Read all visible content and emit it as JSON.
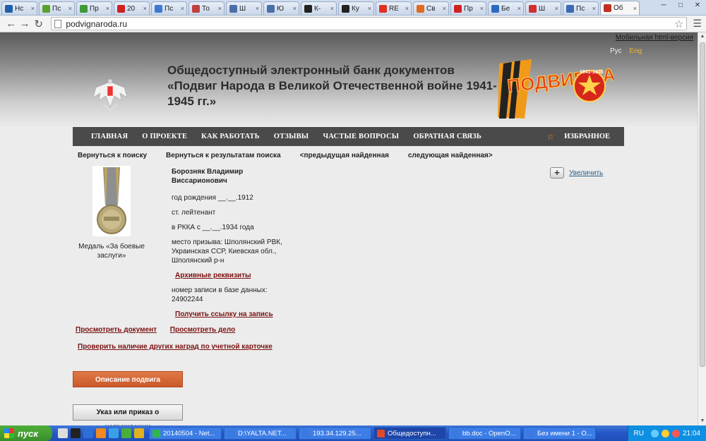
{
  "browser": {
    "tabs": [
      {
        "label": "Нс",
        "icon": "ni-icon",
        "color": "#1f5fa8"
      },
      {
        "label": "Пс",
        "icon": "green-f-icon",
        "color": "#5aa02c"
      },
      {
        "label": "Пр",
        "icon": "green-arrow-icon",
        "color": "#3f9a3a"
      },
      {
        "label": "20",
        "icon": "red-circle-icon",
        "color": "#d02020"
      },
      {
        "label": "Пс",
        "icon": "blue-page-icon",
        "color": "#3b7ad0"
      },
      {
        "label": "То",
        "icon": "pencil-icon",
        "color": "#c04040"
      },
      {
        "label": "Ш",
        "icon": "vk-icon",
        "color": "#4a6ea8"
      },
      {
        "label": "Ю",
        "icon": "vk-icon",
        "color": "#4a6ea8"
      },
      {
        "label": "К-",
        "icon": "iron-cross-icon",
        "color": "#222222"
      },
      {
        "label": "Ку",
        "icon": "iron-cross-icon",
        "color": "#222222"
      },
      {
        "label": "RE",
        "icon": "n-icon",
        "color": "#e03020"
      },
      {
        "label": "Св",
        "icon": "orange-page-icon",
        "color": "#e06a20"
      },
      {
        "label": "Пр",
        "icon": "red-ring-icon",
        "color": "#d02020"
      },
      {
        "label": "Бе",
        "icon": "arrow-icon",
        "color": "#2a6ac0"
      },
      {
        "label": "Ш",
        "icon": "red-circle-icon",
        "color": "#d03030"
      },
      {
        "label": "Пс",
        "icon": "eagle-icon",
        "color": "#3a6ab0"
      },
      {
        "label": "Об",
        "icon": "medal-icon",
        "color": "#c03020",
        "active": true
      }
    ],
    "url": "podvignaroda.ru"
  },
  "site": {
    "mobile_link": "Мобильная html-версия",
    "lang_ru": "Рус",
    "lang_en": "Eng",
    "title": "Общедоступный электронный банк документов «Подвиг Народа в Великой Отечественной войне 1941-1945 гг.»",
    "logo_text": "ПОДВИГ НАРОДА",
    "logo_years": "1941-1945"
  },
  "nav": {
    "items": [
      "ГЛАВНАЯ",
      "О ПРОЕКТЕ",
      "КАК РАБОТАТЬ",
      "ОТЗЫВЫ",
      "ЧАСТЫЕ ВОПРОСЫ",
      "ОБРАТНАЯ СВЯЗЬ"
    ],
    "favorites": "ИЗБРАННОЕ"
  },
  "subnav": {
    "back_search": "Вернуться к поиску",
    "back_results": "Вернуться к результатам поиска",
    "prev_found": "<предыдущая найденная",
    "next_found": "следующая найденная>"
  },
  "record": {
    "medal_caption": "Медаль «За боевые заслуги»",
    "name": "Борозняк Владимир Виссарионович",
    "birth": "год рождения __.__.1912",
    "rank": "ст. лейтенант",
    "rkka": "в РККА с __.__.1934 года",
    "draft_place": "место призыва: Шполянский РВК, Украинская ССР, Киевская обл., Шполянский р-н",
    "archive_link": "Архивные реквизиты",
    "record_number": "номер записи в базе данных: 24902244",
    "get_link": "Получить ссылку на запись",
    "zoom": "Увеличить"
  },
  "actions": {
    "view_document": "Просмотреть документ",
    "view_case": "Просмотреть дело",
    "check_other_awards": "Проверить наличие других наград по учетной карточке",
    "feat_description": "Описание подвига",
    "order": "Указ или приказ о награждении"
  },
  "taskbar": {
    "start": "пуск",
    "tasks": [
      {
        "label": "20140504 - Net...",
        "color": "#2fb84a"
      },
      {
        "label": "D:\\YALTA.NET...",
        "color": "#3a7ae0"
      },
      {
        "label": "193.34.129.25...",
        "color": "#3a7ae0"
      },
      {
        "label": "Общедоступн...",
        "color": "#e04a2a",
        "active": true
      },
      {
        "label": "bb.doc - OpenO...",
        "color": "#3a7ae0"
      },
      {
        "label": "Без имени 1 - О...",
        "color": "#3a7ae0"
      }
    ],
    "lang": "RU",
    "time": "21:04"
  }
}
